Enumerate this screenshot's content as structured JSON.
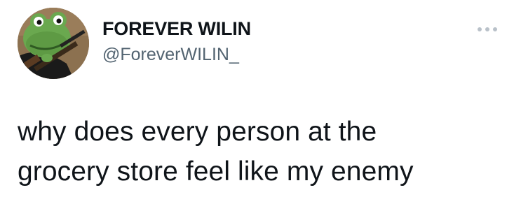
{
  "tweet": {
    "author": {
      "display_name": "FOREVER WILIN",
      "handle": "@ForeverWILIN_",
      "avatar_icon": "frog-holding-rifle-avatar"
    },
    "more_icon": "more-options-icon",
    "text_lines": [
      "why does every person at the",
      "grocery store feel like my enemy"
    ]
  },
  "colors": {
    "background": "#ffffff",
    "primary_text": "#0f1419",
    "secondary_text": "#536471",
    "more_icon": "#b9c1c9"
  }
}
